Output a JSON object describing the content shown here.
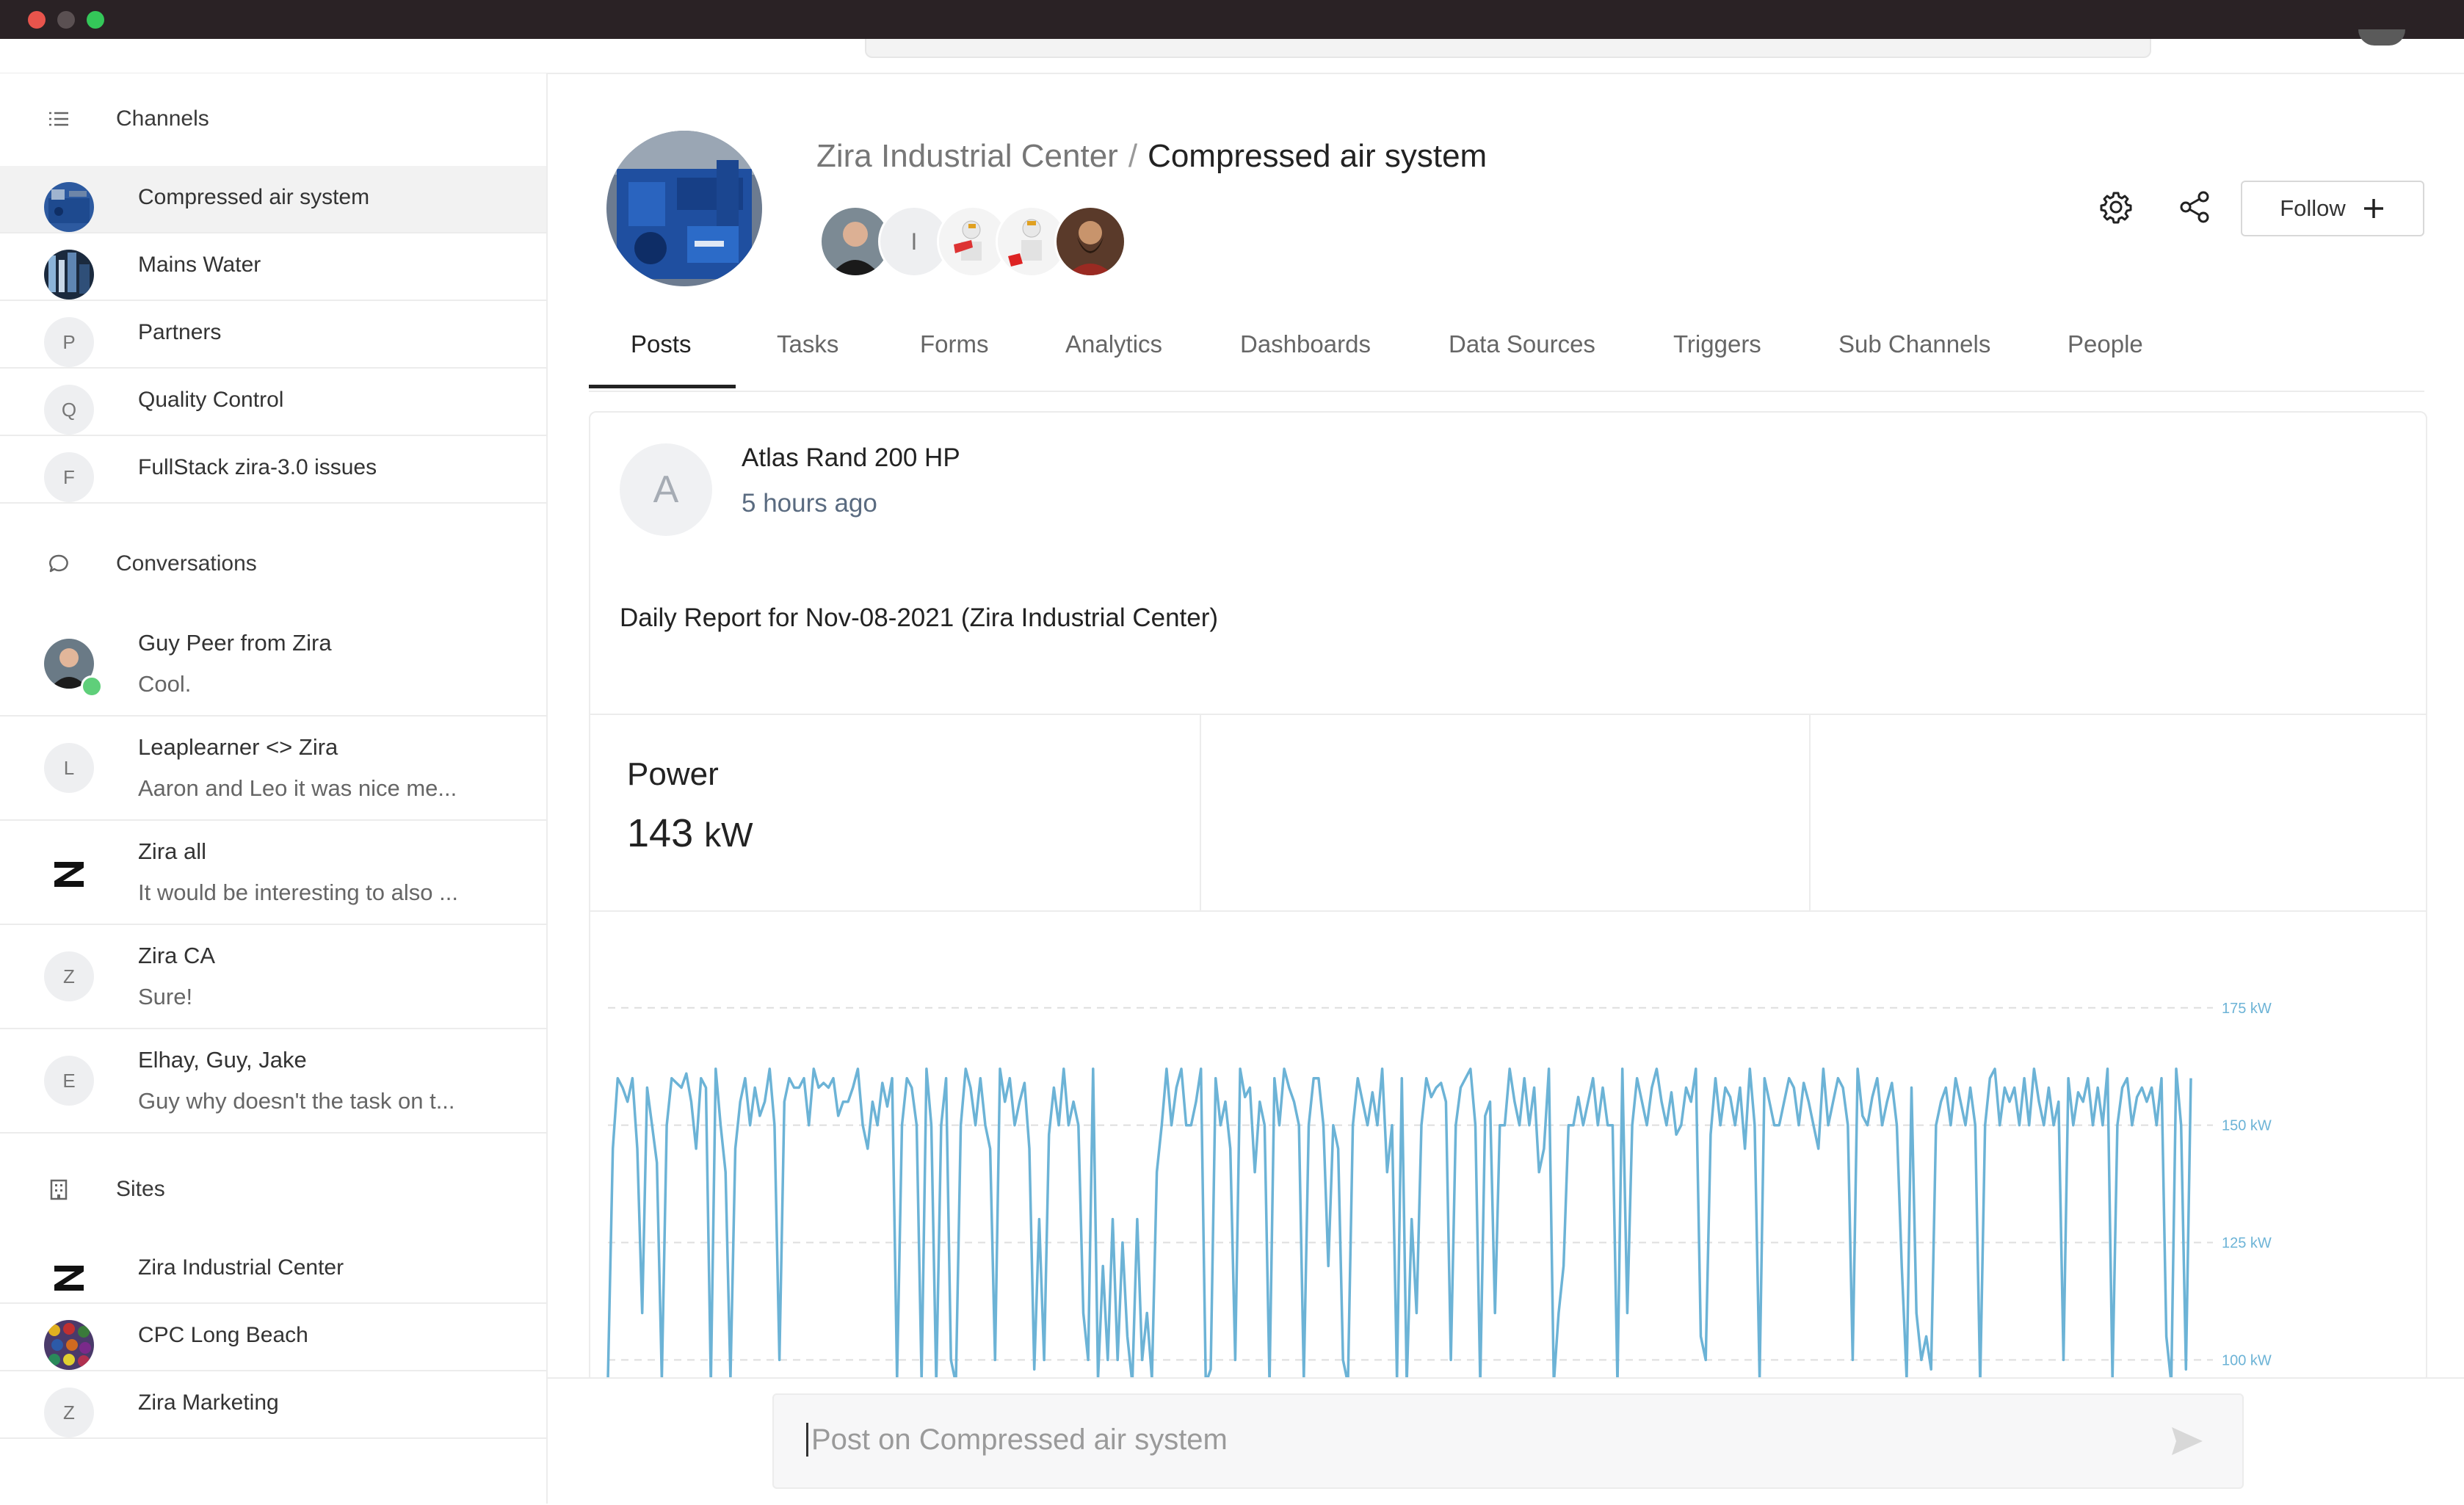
{
  "sidebar": {
    "channels_heading": "Channels",
    "channels": [
      {
        "label": "Compressed air system",
        "avatar": "photo-compressor",
        "active": true
      },
      {
        "label": "Mains Water",
        "avatar": "photo-water"
      },
      {
        "label": "Partners",
        "avatar_letter": "P"
      },
      {
        "label": "Quality Control",
        "avatar_letter": "Q"
      },
      {
        "label": "FullStack zira-3.0 issues",
        "avatar_letter": "F"
      }
    ],
    "conversations_heading": "Conversations",
    "conversations": [
      {
        "title": "Guy Peer from Zira",
        "snippet": "Cool.",
        "avatar": "photo-person",
        "online": true
      },
      {
        "title": "Leaplearner <> Zira",
        "snippet": "Aaron and Leo it was nice me...",
        "avatar_letter": "L"
      },
      {
        "title": "Zira all",
        "snippet": "It would be interesting to also ...",
        "avatar": "zira-logo"
      },
      {
        "title": "Zira CA",
        "snippet": "Sure!",
        "avatar_letter": "Z"
      },
      {
        "title": "Elhay, Guy, Jake",
        "snippet": "Guy why doesn't the task on t...",
        "avatar_letter": "E"
      }
    ],
    "sites_heading": "Sites",
    "sites": [
      {
        "label": "Zira Industrial Center",
        "avatar": "zira-logo"
      },
      {
        "label": "CPC Long Beach",
        "avatar": "photo-beads"
      },
      {
        "label": "Zira Marketing",
        "avatar_letter": "Z"
      }
    ]
  },
  "header": {
    "site": "Zira Industrial Center",
    "separator": "/",
    "channel": "Compressed air system",
    "member_letter": "I",
    "follow_label": "Follow"
  },
  "tabs": [
    "Posts",
    "Tasks",
    "Forms",
    "Analytics",
    "Dashboards",
    "Data Sources",
    "Triggers",
    "Sub Channels",
    "People"
  ],
  "active_tab": "Posts",
  "post": {
    "avatar_letter": "A",
    "author": "Atlas Rand 200 HP",
    "time": "5 hours ago",
    "body": "Daily Report for Nov-08-2021 (Zira Industrial Center)",
    "metric_label": "Power",
    "metric_value": "143",
    "metric_unit": "kW"
  },
  "chart_data": {
    "type": "line",
    "y_tick_labels": [
      "175 kW",
      "150 kW",
      "125 kW",
      "100 kW"
    ],
    "y_ticks": [
      175,
      150,
      125,
      100
    ],
    "ylim": [
      96,
      182
    ],
    "grid": true,
    "color": "#6cb3d6",
    "series": [
      {
        "values": [
          96,
          145,
          160,
          158,
          155,
          160,
          145,
          110,
          158,
          150,
          142,
          96,
          150,
          160,
          159,
          158,
          161,
          155,
          145,
          160,
          158,
          95,
          162,
          150,
          140,
          96,
          145,
          155,
          160,
          150,
          158,
          152,
          155,
          162,
          150,
          100,
          155,
          160,
          158,
          158,
          160,
          150,
          162,
          158,
          159,
          158,
          160,
          152,
          155,
          155,
          158,
          162,
          150,
          145,
          155,
          150,
          159,
          154,
          160,
          96,
          150,
          160,
          158,
          150,
          96,
          162,
          150,
          95,
          150,
          160,
          100,
          95,
          150,
          162,
          158,
          150,
          160,
          150,
          145,
          100,
          162,
          155,
          160,
          150,
          155,
          159,
          145,
          98,
          130,
          100,
          148,
          158,
          150,
          162,
          150,
          155,
          150,
          110,
          100,
          162,
          96,
          120,
          100,
          130,
          100,
          125,
          105,
          95,
          130,
          100,
          110,
          96,
          140,
          150,
          162,
          150,
          158,
          162,
          150,
          150,
          155,
          162,
          95,
          98,
          160,
          150,
          155,
          145,
          100,
          162,
          156,
          158,
          140,
          155,
          150,
          95,
          160,
          150,
          162,
          158,
          155,
          150,
          96,
          150,
          160,
          160,
          150,
          120,
          150,
          145,
          100,
          95,
          150,
          160,
          155,
          150,
          157,
          150,
          162,
          140,
          150,
          96,
          160,
          95,
          130,
          110,
          150,
          160,
          156,
          158,
          159,
          155,
          100,
          150,
          158,
          160,
          162,
          150,
          95,
          152,
          155,
          110,
          150,
          150,
          162,
          155,
          150,
          160,
          150,
          158,
          140,
          145,
          162,
          95,
          110,
          120,
          150,
          150,
          156,
          150,
          155,
          160,
          150,
          158,
          150,
          150,
          95,
          162,
          110,
          150,
          160,
          155,
          150,
          158,
          162,
          155,
          150,
          157,
          148,
          150,
          158,
          155,
          162,
          105,
          100,
          148,
          160,
          150,
          158,
          156,
          150,
          158,
          145,
          162,
          150,
          96,
          160,
          155,
          150,
          150,
          155,
          160,
          158,
          150,
          159,
          155,
          150,
          145,
          162,
          150,
          155,
          160,
          158,
          150,
          100,
          162,
          152,
          150,
          156,
          160,
          150,
          155,
          159,
          150,
          120,
          96,
          158,
          110,
          100,
          105,
          98,
          150,
          155,
          158,
          150,
          160,
          155,
          150,
          158,
          150,
          95,
          150,
          160,
          162,
          150,
          158,
          155,
          158,
          150,
          160,
          150,
          162,
          155,
          150,
          158,
          150,
          155,
          100,
          160,
          150,
          157,
          155,
          160,
          150,
          158,
          150,
          162,
          96,
          150,
          158,
          160,
          150,
          156,
          158,
          155,
          158,
          150,
          160,
          105,
          95,
          162,
          150,
          98,
          160
        ]
      }
    ]
  }
}
